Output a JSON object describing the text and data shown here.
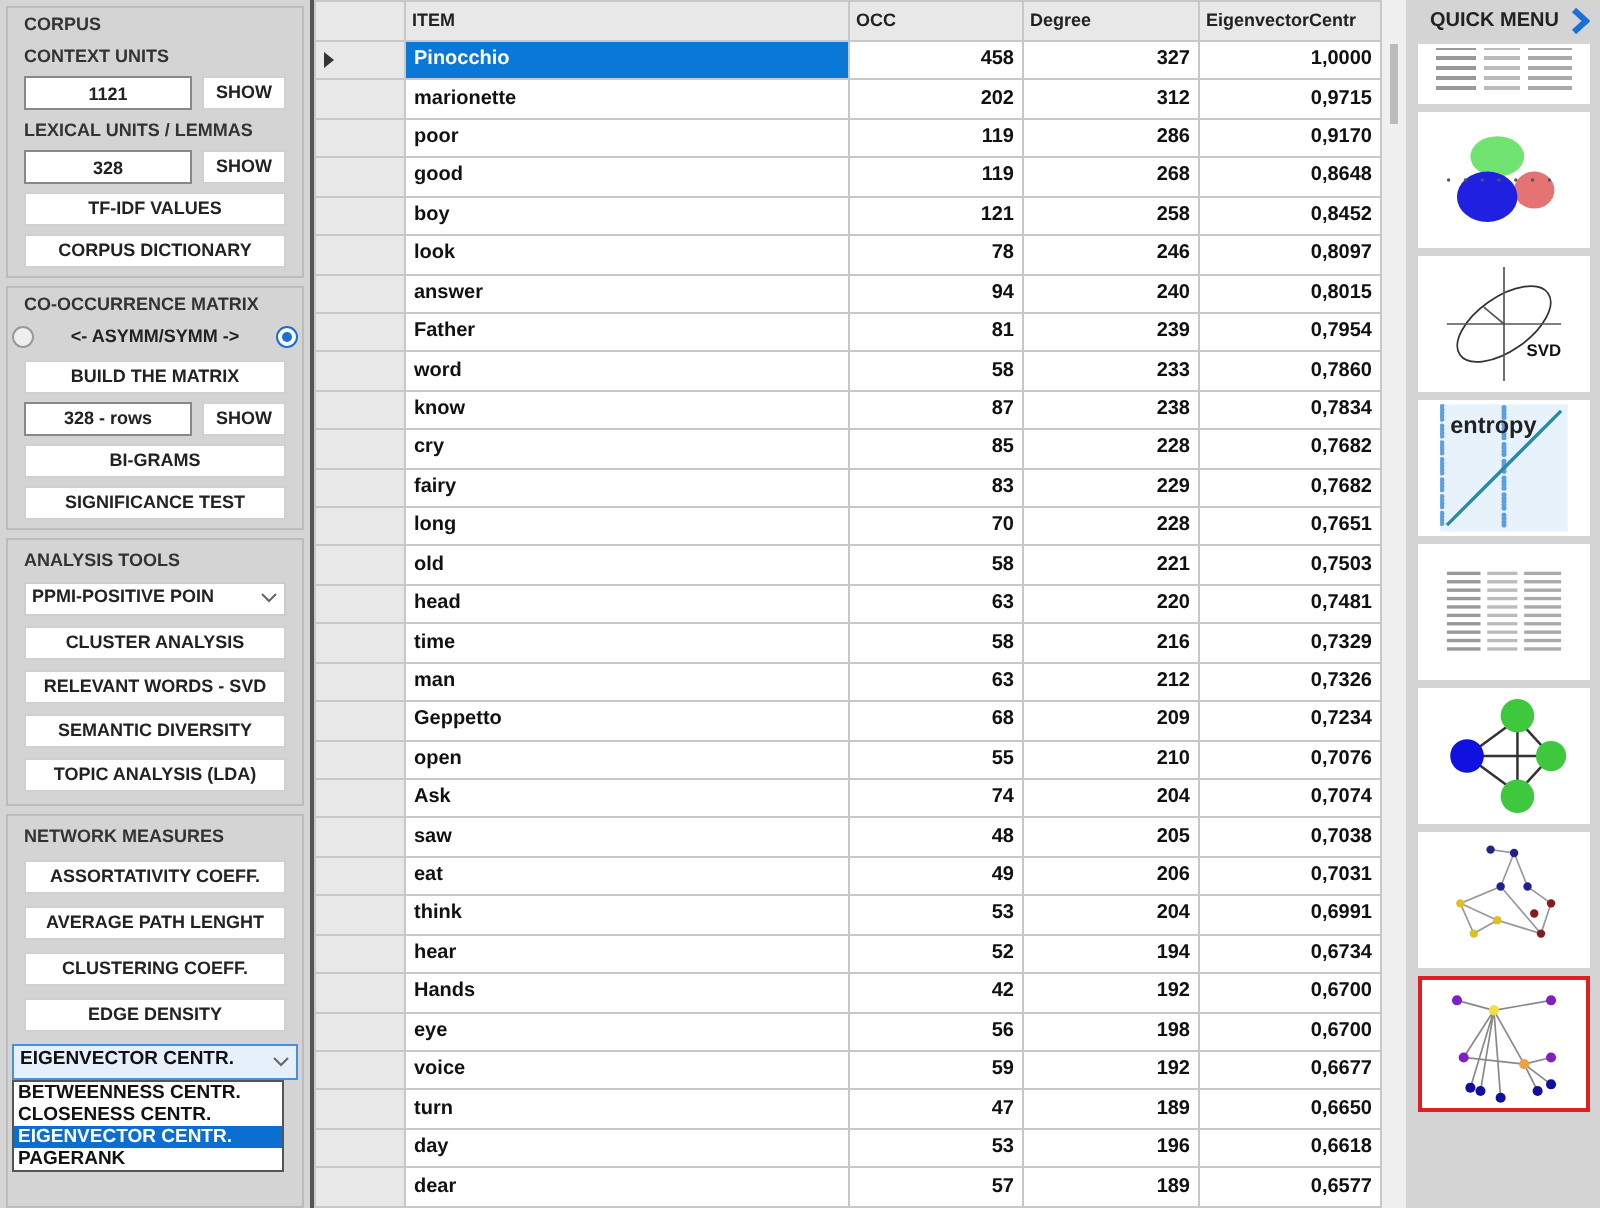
{
  "corpus": {
    "title": "CORPUS",
    "context_label": "CONTEXT UNITS",
    "context_value": "1121",
    "context_button": "SHOW",
    "lexical_label": "LEXICAL UNITS / LEMMAS",
    "lexical_value": "328",
    "lexical_button": "SHOW",
    "buttons": [
      "TF-IDF VALUES",
      "CORPUS DICTIONARY"
    ]
  },
  "matrix": {
    "title": "CO-OCCURRENCE MATRIX",
    "toggle_label": "<- ASYMM/SYMM ->",
    "asymm_selected": false,
    "symm_selected": true,
    "build_button": "BUILD THE MATRIX",
    "rows_value": "328 - rows",
    "rows_button": "SHOW",
    "buttons": [
      "BI-GRAMS",
      "SIGNIFICANCE TEST"
    ]
  },
  "analysis": {
    "title": "ANALYSIS TOOLS",
    "dropdown": "PPMI-POSITIVE POIN",
    "buttons": [
      "CLUSTER ANALYSIS",
      "RELEVANT WORDS - SVD",
      "SEMANTIC DIVERSITY",
      "TOPIC ANALYSIS (LDA)"
    ]
  },
  "network": {
    "title": "NETWORK MEASURES",
    "buttons": [
      "ASSORTATIVITY COEFF.",
      "AVERAGE PATH LENGHT",
      "CLUSTERING COEFF.",
      "EDGE DENSITY"
    ],
    "dropdown": "EIGENVECTOR CENTR.",
    "options": [
      {
        "label": "BETWEENNESS CENTR.",
        "selected": false
      },
      {
        "label": "CLOSENESS CENTR.",
        "selected": false
      },
      {
        "label": "EIGENVECTOR CENTR.",
        "selected": true
      },
      {
        "label": "PAGERANK",
        "selected": false
      }
    ]
  },
  "table": {
    "columns": [
      "ITEM",
      "OCC",
      "Degree",
      "EigenvectorCentr"
    ],
    "rows": [
      {
        "item": "Pinocchio",
        "occ": "458",
        "degree": "327",
        "centrality": "1,0000",
        "selected": true
      },
      {
        "item": "marionette",
        "occ": "202",
        "degree": "312",
        "centrality": "0,9715",
        "selected": false
      },
      {
        "item": "poor",
        "occ": "119",
        "degree": "286",
        "centrality": "0,9170",
        "selected": false
      },
      {
        "item": "good",
        "occ": "119",
        "degree": "268",
        "centrality": "0,8648",
        "selected": false
      },
      {
        "item": "boy",
        "occ": "121",
        "degree": "258",
        "centrality": "0,8452",
        "selected": false
      },
      {
        "item": "look",
        "occ": "78",
        "degree": "246",
        "centrality": "0,8097",
        "selected": false
      },
      {
        "item": "answer",
        "occ": "94",
        "degree": "240",
        "centrality": "0,8015",
        "selected": false
      },
      {
        "item": "Father",
        "occ": "81",
        "degree": "239",
        "centrality": "0,7954",
        "selected": false
      },
      {
        "item": "word",
        "occ": "58",
        "degree": "233",
        "centrality": "0,7860",
        "selected": false
      },
      {
        "item": "know",
        "occ": "87",
        "degree": "238",
        "centrality": "0,7834",
        "selected": false
      },
      {
        "item": "cry",
        "occ": "85",
        "degree": "228",
        "centrality": "0,7682",
        "selected": false
      },
      {
        "item": "fairy",
        "occ": "83",
        "degree": "229",
        "centrality": "0,7682",
        "selected": false
      },
      {
        "item": "long",
        "occ": "70",
        "degree": "228",
        "centrality": "0,7651",
        "selected": false
      },
      {
        "item": "old",
        "occ": "58",
        "degree": "221",
        "centrality": "0,7503",
        "selected": false
      },
      {
        "item": "head",
        "occ": "63",
        "degree": "220",
        "centrality": "0,7481",
        "selected": false
      },
      {
        "item": "time",
        "occ": "58",
        "degree": "216",
        "centrality": "0,7329",
        "selected": false
      },
      {
        "item": "man",
        "occ": "63",
        "degree": "212",
        "centrality": "0,7326",
        "selected": false
      },
      {
        "item": "Geppetto",
        "occ": "68",
        "degree": "209",
        "centrality": "0,7234",
        "selected": false
      },
      {
        "item": "open",
        "occ": "55",
        "degree": "210",
        "centrality": "0,7076",
        "selected": false
      },
      {
        "item": "Ask",
        "occ": "74",
        "degree": "204",
        "centrality": "0,7074",
        "selected": false
      },
      {
        "item": "saw",
        "occ": "48",
        "degree": "205",
        "centrality": "0,7038",
        "selected": false
      },
      {
        "item": "eat",
        "occ": "49",
        "degree": "206",
        "centrality": "0,7031",
        "selected": false
      },
      {
        "item": "think",
        "occ": "53",
        "degree": "204",
        "centrality": "0,6991",
        "selected": false
      },
      {
        "item": "hear",
        "occ": "52",
        "degree": "194",
        "centrality": "0,6734",
        "selected": false
      },
      {
        "item": "Hands",
        "occ": "42",
        "degree": "192",
        "centrality": "0,6700",
        "selected": false
      },
      {
        "item": "eye",
        "occ": "56",
        "degree": "198",
        "centrality": "0,6700",
        "selected": false
      },
      {
        "item": "voice",
        "occ": "59",
        "degree": "192",
        "centrality": "0,6677",
        "selected": false
      },
      {
        "item": "turn",
        "occ": "47",
        "degree": "189",
        "centrality": "0,6650",
        "selected": false
      },
      {
        "item": "day",
        "occ": "53",
        "degree": "196",
        "centrality": "0,6618",
        "selected": false
      },
      {
        "item": "dear",
        "occ": "57",
        "degree": "189",
        "centrality": "0,6577",
        "selected": false
      }
    ]
  },
  "quick_menu": {
    "title": "QUICK MENU",
    "items": [
      {
        "kind": "table",
        "selected": false
      },
      {
        "kind": "clusters",
        "selected": false
      },
      {
        "kind": "svd",
        "label": "SVD",
        "selected": false
      },
      {
        "kind": "entropy",
        "label": "entropy",
        "selected": false
      },
      {
        "kind": "table",
        "selected": false
      },
      {
        "kind": "graph",
        "selected": false
      },
      {
        "kind": "network",
        "selected": false
      },
      {
        "kind": "star",
        "selected": true
      }
    ]
  }
}
